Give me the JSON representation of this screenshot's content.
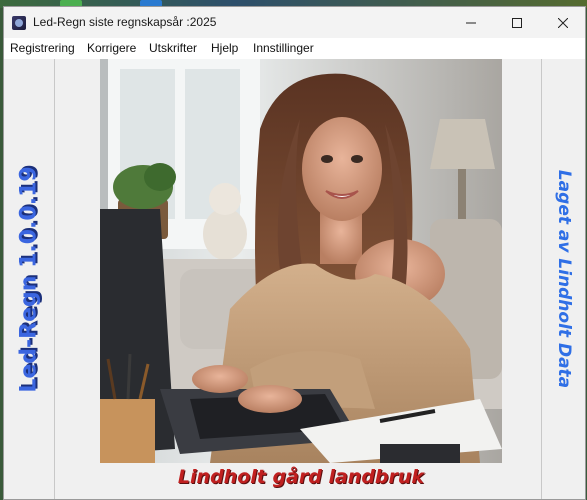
{
  "window": {
    "title": "Led-Regn siste regnskapsår :2025",
    "controls": [
      "minimize-icon",
      "maximize-icon",
      "close-icon"
    ]
  },
  "menu": {
    "items": [
      "Registrering",
      "Korrigere",
      "Utskrifter",
      "Hjelp",
      "Innstillinger"
    ]
  },
  "main": {
    "left_label": "Led-Regn 1.0.0.19",
    "right_label": "Laget av Lindholt Data",
    "caption": "Lindholt gård landbruk",
    "image": "woman-with-laptop-photo"
  },
  "colors": {
    "left_label": "#3b66e0",
    "right_label": "#2f6fe6",
    "caption": "#c02020"
  }
}
